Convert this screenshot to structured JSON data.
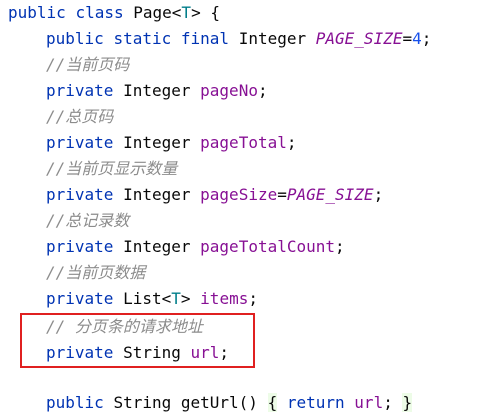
{
  "code": {
    "line1": {
      "kw1": "public",
      "kw2": "class",
      "name": "Page",
      "lt": "<",
      "tparam": "T",
      "gt": ">",
      "brace": "{"
    },
    "line2": {
      "kw1": "public",
      "kw2": "static",
      "kw3": "final",
      "type": "Integer",
      "name": "PAGE_SIZE",
      "eq": "=",
      "value": "4",
      "semi": ";"
    },
    "comment1": "//当前页码",
    "line4": {
      "kw": "private",
      "type": "Integer",
      "name": "pageNo",
      "semi": ";"
    },
    "comment2": "//总页码",
    "line6": {
      "kw": "private",
      "type": "Integer",
      "name": "pageTotal",
      "semi": ";"
    },
    "comment3": "//当前页显示数量",
    "line8": {
      "kw": "private",
      "type": "Integer",
      "name": "pageSize",
      "eq": "=",
      "value": "PAGE_SIZE",
      "semi": ";"
    },
    "comment4": "//总记录数",
    "line10": {
      "kw": "private",
      "type": "Integer",
      "name": "pageTotalCount",
      "semi": ";"
    },
    "comment5": "//当前页数据",
    "line12": {
      "kw": "private",
      "type": "List",
      "lt": "<",
      "tparam": "T",
      "gt": ">",
      "name": "items",
      "semi": ";"
    },
    "comment6": "// 分页条的请求地址",
    "line14": {
      "kw": "private",
      "type": "String",
      "name": "url",
      "semi": ";"
    },
    "partial": {
      "kw": "public",
      "type": "String",
      "method": "getUrl",
      "parens": "()",
      "open": "{",
      "ret": "return",
      "field": "url",
      "close": "}"
    }
  },
  "colors": {
    "keyword": "#0033b3",
    "constant": "#871094",
    "field": "#871094",
    "number": "#1750eb",
    "comment": "#8c8c8c",
    "highlight_border": "#e02020"
  }
}
